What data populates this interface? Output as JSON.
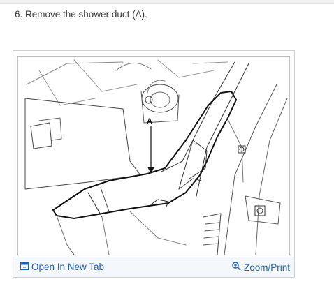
{
  "step": {
    "text": "6. Remove the shower duct (A)."
  },
  "figure": {
    "callout_label": "A"
  },
  "footer": {
    "open_label": "Open In New Tab",
    "open_icon": "new-tab-icon",
    "zoom_label": "Zoom/Print",
    "zoom_icon": "magnifier-plus-icon",
    "link_color": "#1f5fb2"
  }
}
